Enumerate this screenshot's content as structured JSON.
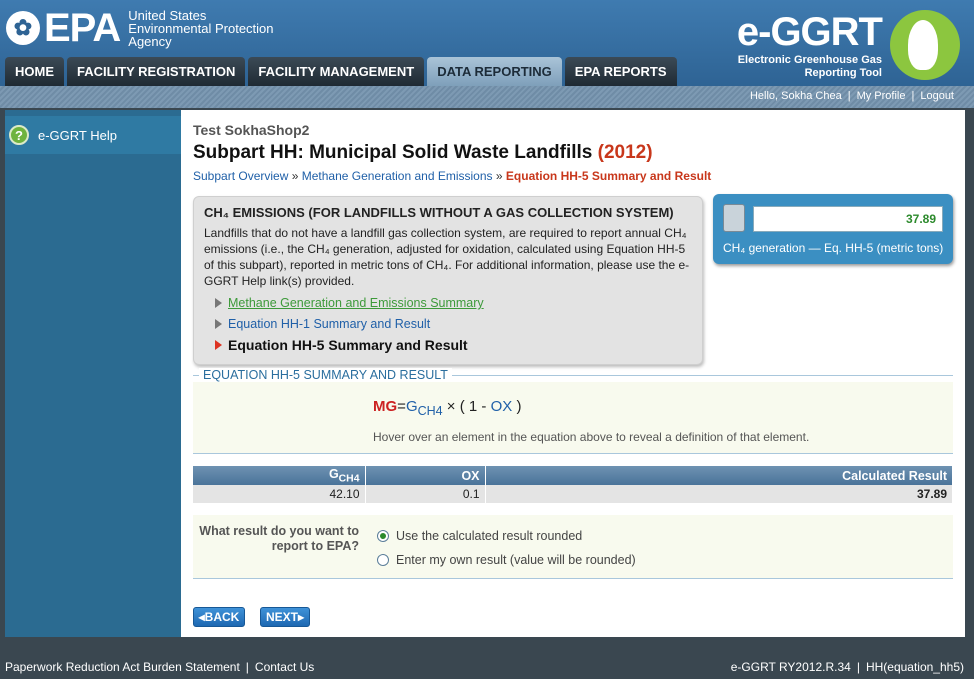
{
  "header": {
    "epa_mark": "EPA",
    "agency_line1": "United States",
    "agency_line2": "Environmental Protection",
    "agency_line3": "Agency",
    "app_name": "e-GGRT",
    "app_sub_line1": "Electronic Greenhouse Gas",
    "app_sub_line2": "Reporting Tool"
  },
  "nav": {
    "tabs": [
      {
        "label": "HOME"
      },
      {
        "label": "FACILITY REGISTRATION"
      },
      {
        "label": "FACILITY MANAGEMENT"
      },
      {
        "label": "DATA REPORTING"
      },
      {
        "label": "EPA REPORTS"
      }
    ],
    "active": "DATA REPORTING"
  },
  "userbar": {
    "greeting": "Hello, Sokha Chea",
    "profile": "My Profile",
    "logout": "Logout",
    "separator": "|"
  },
  "sidebar": {
    "help_label": "e-GGRT Help",
    "help_icon": "?"
  },
  "main": {
    "facility": "Test SokhaShop2",
    "title": "Subpart HH: Municipal Solid Waste Landfills",
    "year": "(2012)",
    "breadcrumb": {
      "item1": "Subpart Overview",
      "sep": "»",
      "item2": "Methane Generation and Emissions",
      "current": "Equation HH-5 Summary and Result"
    },
    "info": {
      "title": "CH₄ EMISSIONS (FOR LANDFILLS WITHOUT A GAS COLLECTION SYSTEM)",
      "text": "Landfills that do not have a landfill gas collection system, are required to report annual CH₄ emissions (i.e., the CH₄ generation, adjusted for oxidation, calculated using Equation HH-5 of this subpart), reported in metric tons of CH₄. For additional information, please use the e-GGRT Help link(s) provided.",
      "steps": [
        {
          "label": "Methane Generation and Emissions Summary"
        },
        {
          "label": "Equation HH-1 Summary and Result"
        },
        {
          "label": "Equation HH-5 Summary and Result"
        }
      ]
    },
    "result": {
      "value": "37.89",
      "label": "CH₄ generation — Eq. HH-5 (metric tons)"
    },
    "equation_section": {
      "title": "EQUATION HH-5 SUMMARY AND RESULT",
      "mg": "MG",
      "eq": "=",
      "g": "G",
      "g_sub": "CH4",
      "times": "×",
      "open": "( 1 -",
      "ox": "OX",
      "close": ")",
      "hover_text": "Hover over an element in the equation above to reveal a definition of that element."
    },
    "table": {
      "headers": {
        "g": "G",
        "g_sub": "CH4",
        "ox": "OX",
        "result": "Calculated Result"
      },
      "row": {
        "g": "42.10",
        "ox": "0.1",
        "result": "37.89"
      }
    },
    "choice": {
      "question": "What result do you want to report to EPA?",
      "option1": "Use the calculated result rounded",
      "option2": "Enter my own result (value will be rounded)"
    },
    "buttons": {
      "back": "◂BACK",
      "next": "NEXT▸"
    }
  },
  "footer": {
    "paperwork": "Paperwork Reduction Act Burden Statement",
    "contact": "Contact Us",
    "separator": "|",
    "version": "e-GGRT RY2012.R.34",
    "page_id": "HH(equation_hh5)"
  },
  "colors": {
    "header_blue": "#2e6394",
    "sidebar_blue": "#2b6b91",
    "title_red": "#c8371b",
    "link_blue": "#2060a8",
    "result_green": "#2c8a2c"
  }
}
